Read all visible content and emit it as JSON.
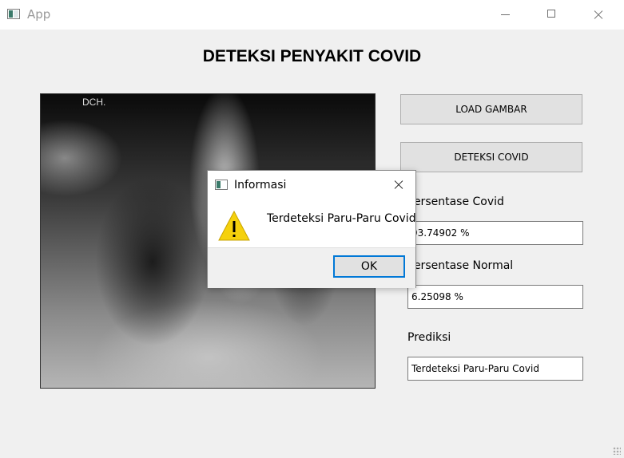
{
  "window": {
    "title": "App"
  },
  "heading": "DETEKSI PENYAKIT COVID",
  "image": {
    "overlay_text": "DCH."
  },
  "buttons": {
    "load": "LOAD GAMBAR",
    "detect": "DETEKSI COVID"
  },
  "fields": {
    "covid_label": "Persentase Covid",
    "covid_value": "93.74902 %",
    "normal_label": "Persentase Normal",
    "normal_value": "6.25098 %",
    "prediction_label": "Prediksi",
    "prediction_value": "Terdeteksi Paru-Paru Covid"
  },
  "dialog": {
    "title": "Informasi",
    "message": "Terdeteksi Paru-Paru Covid",
    "ok_label": "OK",
    "icon": "warning-icon"
  },
  "colors": {
    "accent": "#0078d7",
    "warning": "#f5d10c"
  }
}
